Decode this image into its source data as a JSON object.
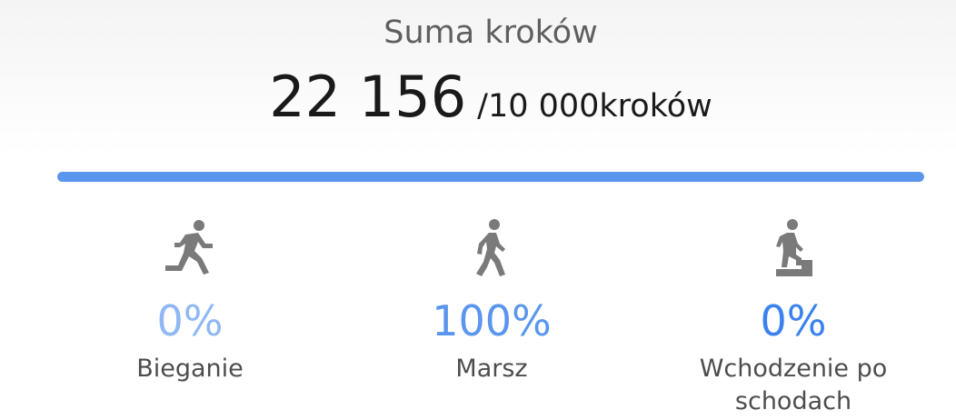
{
  "summary": {
    "title": "Suma kroków",
    "steps": "22 156",
    "goal": "/10 000kroków",
    "progress_percent": 100
  },
  "stats": [
    {
      "icon": "running-icon",
      "percent": "0%",
      "label": "Bieganie",
      "color": "#8fb8f4"
    },
    {
      "icon": "walking-icon",
      "percent": "100%",
      "label": "Marsz",
      "color": "#5a95ee"
    },
    {
      "icon": "stairs-climbing-icon",
      "percent": "0%",
      "label": "Wchodzenie po schodach",
      "color": "#3b82ee"
    }
  ],
  "colors": {
    "accent": "#5a95ee",
    "icon": "#7a7a7a"
  }
}
